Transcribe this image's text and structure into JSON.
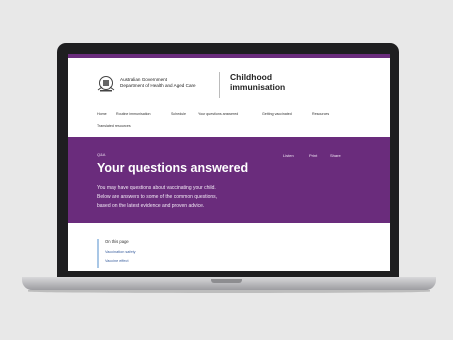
{
  "header": {
    "govt_line1": "Australian Government",
    "govt_line2": "Department of Health and Aged Care",
    "site_title_line1": "Childhood",
    "site_title_line2": "immunisation"
  },
  "nav": {
    "items": [
      "Home",
      "Routine immunisation",
      "Schedule",
      "Your questions answered",
      "Getting vaccinated",
      "Resources",
      "Translated resources"
    ]
  },
  "hero": {
    "breadcrumb": "Q&A",
    "title": "Your questions answered",
    "description": [
      "You may have questions about vaccinating your child.",
      "Below are answers to some of the common questions,",
      "based on the latest evidence and proven advice."
    ],
    "actions": [
      "Listen",
      "Print",
      "Share"
    ]
  },
  "on_this_page": {
    "title": "On this page",
    "links": [
      "Vaccination safety",
      "Vaccine effect"
    ]
  },
  "colors": {
    "brand_purple": "#6a2c7c",
    "background": "#e8e8e8",
    "bezel": "#1e1e20"
  }
}
